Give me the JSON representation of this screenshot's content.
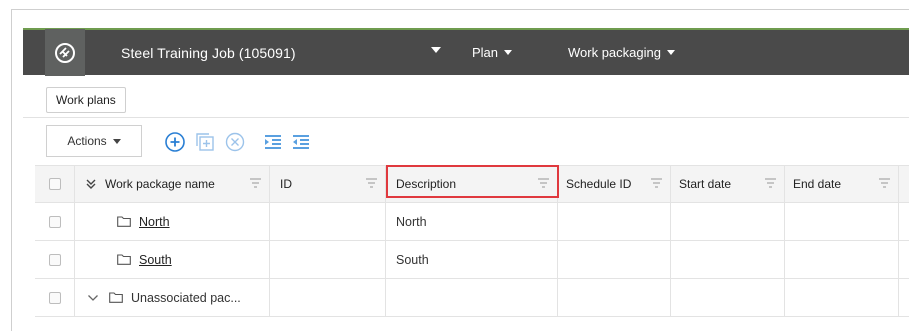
{
  "header": {
    "job_title": "Steel Training Job (105091)",
    "menu_plan": "Plan",
    "menu_work_packaging": "Work packaging",
    "bar_color": "#4a4a4a",
    "accent_color": "#6f9c4f"
  },
  "tabs": {
    "work_plans": "Work plans"
  },
  "toolbar": {
    "actions_label": "Actions",
    "icons": [
      "add-circle-icon",
      "add-box-icon",
      "remove-circle-icon",
      "indent-icon",
      "outdent-icon"
    ],
    "icon_color": "#2a7fd4"
  },
  "table": {
    "columns": {
      "name": "Work package name",
      "id": "ID",
      "description": "Description",
      "schedule_id": "Schedule ID",
      "start_date": "Start date",
      "end_date": "End date"
    },
    "rows": [
      {
        "name": "North",
        "id": "",
        "description": "North",
        "schedule_id": "",
        "start_date": "",
        "end_date": ""
      },
      {
        "name": "South",
        "id": "",
        "description": "South",
        "schedule_id": "",
        "start_date": "",
        "end_date": ""
      },
      {
        "name": "Unassociated pac...",
        "id": "",
        "description": "",
        "schedule_id": "",
        "start_date": "",
        "end_date": ""
      }
    ],
    "highlight_color": "#e0393e"
  }
}
